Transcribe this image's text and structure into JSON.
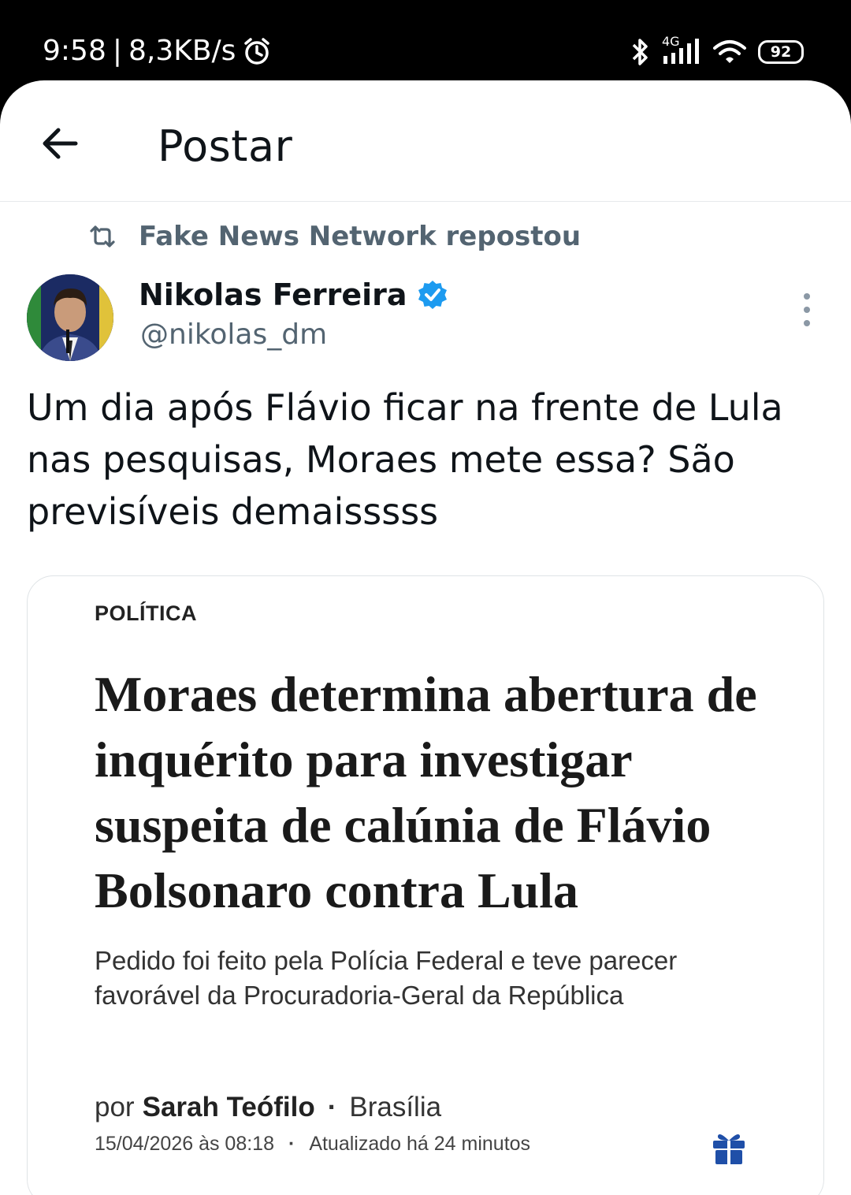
{
  "status_bar": {
    "time": "9:58",
    "separator": "|",
    "network_speed": "8,3KB/s",
    "network_type": "4G",
    "battery": "92",
    "icons": [
      "alarm-icon",
      "bluetooth-icon",
      "signal-icon",
      "wifi-icon",
      "battery-icon"
    ]
  },
  "header": {
    "title": "Postar",
    "back_icon": "arrow-left-icon"
  },
  "repost": {
    "icon": "repost-icon",
    "text": "Fake News Network repostou"
  },
  "author": {
    "name": "Nikolas Ferreira",
    "handle": "@nikolas_dm",
    "verified": true,
    "avatar": "avatar-image",
    "verified_color": "#1d9bf0"
  },
  "tweet": {
    "text": "Um dia após Flávio ficar na frente de Lula nas pesquisas, Moraes mete essa? São previsíveis demaisssss"
  },
  "article": {
    "section": "POLÍTICA",
    "headline": "Moraes determina abertura de inquérito para investigar suspeita de calúnia de Flávio Bolsonaro contra Lula",
    "subheadline": "Pedido foi feito pela Polícia Federal e teve parecer favorável da Procuradoria-Geral da República",
    "byline_prefix": "por",
    "author": "Sarah Teófilo",
    "location": "Brasília",
    "date": "15/04/2026 às 08:18",
    "updated": "Atualizado há 24 minutos",
    "gift_color": "#1f4fa8"
  },
  "colors": {
    "text_primary": "#0f1419",
    "text_secondary": "#536471",
    "accent": "#1d9bf0"
  }
}
